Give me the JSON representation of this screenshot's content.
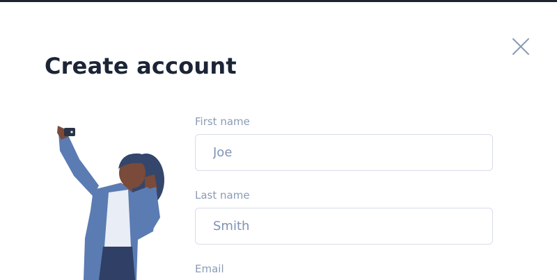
{
  "dialog": {
    "title": "Create account",
    "close_icon": "close-icon"
  },
  "illustration": {
    "icon": "person-taking-selfie-illustration",
    "colors": {
      "jacket": "#5b7bb3",
      "skin": "#7a4a3a",
      "hair": "#34466b",
      "shirt": "#e9edf5",
      "phone": "#2b3446"
    }
  },
  "form": {
    "first_name": {
      "label": "First name",
      "value": "Joe"
    },
    "last_name": {
      "label": "Last name",
      "value": "Smith"
    },
    "email": {
      "label": "Email",
      "value": ""
    }
  },
  "colors": {
    "title": "#1c2536",
    "label": "#8a9bb5",
    "input_text": "#7f93b3",
    "input_border": "#d6dce8",
    "close_icon": "#8a9bb5"
  }
}
